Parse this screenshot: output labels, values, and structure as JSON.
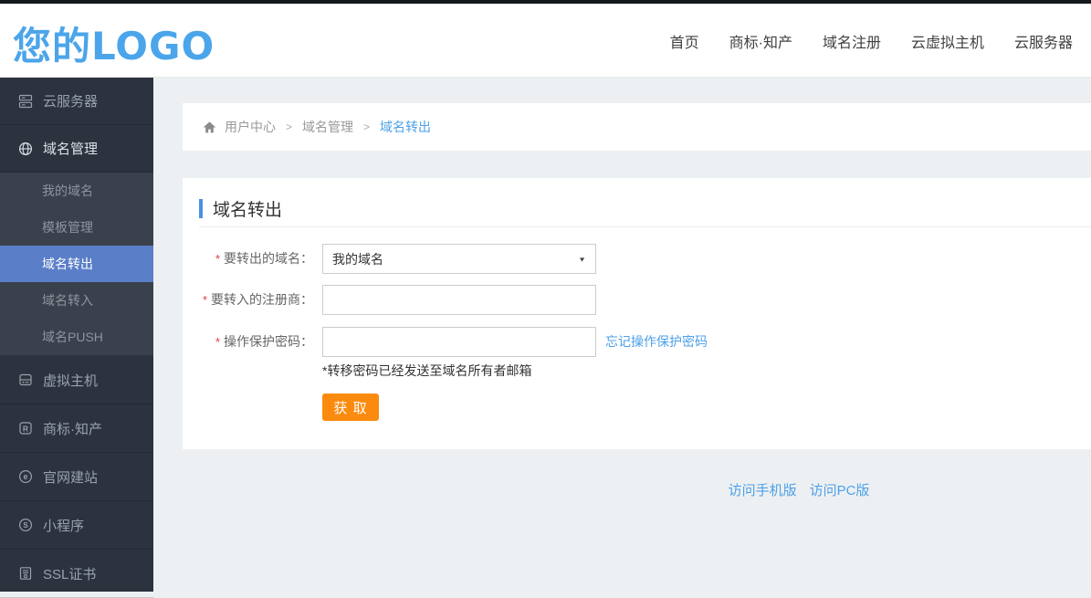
{
  "header": {
    "logo_text": "您的LOGO",
    "nav_items": [
      {
        "label": "首页"
      },
      {
        "label": "商标·知产"
      },
      {
        "label": "域名注册"
      },
      {
        "label": "云虚拟主机"
      },
      {
        "label": "云服务器"
      }
    ]
  },
  "sidebar": {
    "items": [
      {
        "label": "云服务器"
      },
      {
        "label": "域名管理"
      },
      {
        "label": "我的域名"
      },
      {
        "label": "模板管理"
      },
      {
        "label": "域名转出"
      },
      {
        "label": "域名转入"
      },
      {
        "label": "域名PUSH"
      },
      {
        "label": "虚拟主机"
      },
      {
        "label": "商标·知产"
      },
      {
        "label": "官网建站"
      },
      {
        "label": "小程序"
      },
      {
        "label": "SSL证书"
      }
    ]
  },
  "breadcrumb": {
    "separator": ">",
    "items": [
      {
        "label": "用户中心"
      },
      {
        "label": "域名管理"
      },
      {
        "label": "域名转出"
      }
    ]
  },
  "main": {
    "title": "域名转出"
  },
  "form": {
    "required_mark": "*",
    "rows": [
      {
        "label": "要转出的域名：",
        "type": "select",
        "value": "我的域名"
      },
      {
        "label": "要转入的注册商：",
        "type": "text",
        "value": ""
      },
      {
        "label": "操作保护密码：",
        "type": "text",
        "value": "",
        "link_label": "忘记操作保护密码"
      }
    ],
    "note": "*转移密码已经发送至域名所有者邮箱",
    "submit_label": "获 取"
  },
  "footer": {
    "links": [
      {
        "label": "访问手机版"
      },
      {
        "label": "访问PC版"
      }
    ]
  },
  "icons": {
    "select_caret": "▼"
  },
  "colors": {
    "logo_blue": "#4BA5EA",
    "link_blue": "#4DA0E8",
    "active_menu_blue": "#5A7EC8",
    "title_accent_blue": "#4A90E2",
    "button_orange": "#FB8B0E",
    "sidebar_bg": "#2C333E",
    "submenu_bg": "#3A414C",
    "page_bg": "#EDF0F2"
  }
}
